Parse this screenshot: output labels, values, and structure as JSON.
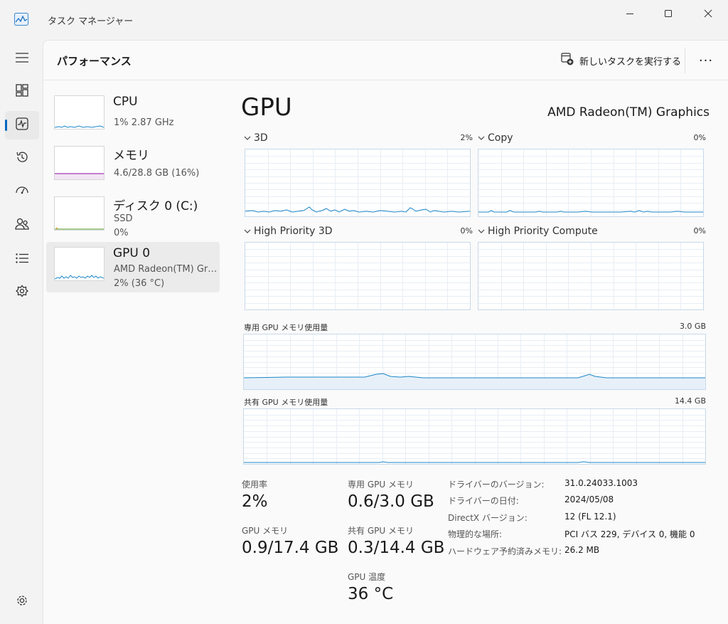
{
  "window": {
    "title": "タスク マネージャー",
    "icon": "task-manager-icon"
  },
  "header": {
    "page_title": "パフォーマンス",
    "run_task_label": "新しいタスクを実行する",
    "more_label": "···"
  },
  "nav": [
    {
      "icon": "hamburger-icon"
    },
    {
      "icon": "processes-icon"
    },
    {
      "icon": "performance-icon",
      "active": true
    },
    {
      "icon": "app-history-icon"
    },
    {
      "icon": "startup-apps-icon"
    },
    {
      "icon": "users-icon"
    },
    {
      "icon": "details-icon"
    },
    {
      "icon": "services-icon"
    },
    {
      "icon": "settings-icon"
    }
  ],
  "devices": [
    {
      "name": "CPU",
      "line1": "1%  2.87 GHz",
      "line2": "",
      "color": "#1a86c8"
    },
    {
      "name": "メモリ",
      "line1": "4.6/28.8 GB (16%)",
      "line2": "",
      "color": "#a23bb0"
    },
    {
      "name": "ディスク 0 (C:)",
      "line1": "SSD",
      "line2": "0%",
      "color": "#4c9a2a"
    },
    {
      "name": "GPU 0",
      "line1": "AMD Radeon(TM) Graphics",
      "line2": "2%  (36 °C)",
      "color": "#1a86c8",
      "selected": true
    }
  ],
  "detail": {
    "title": "GPU",
    "model": "AMD Radeon(TM) Graphics",
    "engines": [
      {
        "label": "3D",
        "pct": "2%"
      },
      {
        "label": "Copy",
        "pct": "0%"
      },
      {
        "label": "High Priority 3D",
        "pct": "0%"
      },
      {
        "label": "High Priority Compute",
        "pct": "0%"
      }
    ],
    "dedicated_mem": {
      "label": "専用 GPU メモリ使用量",
      "max": "3.0 GB"
    },
    "shared_mem": {
      "label": "共有 GPU メモリ使用量",
      "max": "14.4 GB"
    },
    "stats": {
      "usage_label": "使用率",
      "usage_value": "2%",
      "gpu_mem_label": "GPU メモリ",
      "gpu_mem_value": "0.9/17.4 GB",
      "ded_label": "専用 GPU メモリ",
      "ded_value": "0.6/3.0 GB",
      "shared_label": "共有 GPU メモリ",
      "shared_value": "0.3/14.4 GB",
      "temp_label": "GPU 温度",
      "temp_value": "36 °C"
    },
    "info": [
      {
        "key": "ドライバーのバージョン:",
        "value": "31.0.24033.1003"
      },
      {
        "key": "ドライバーの日付:",
        "value": "2024/05/08"
      },
      {
        "key": "DirectX バージョン:",
        "value": "12 (FL 12.1)"
      },
      {
        "key": "物理的な場所:",
        "value": "PCI バス 229, デバイス 0, 機能 0"
      },
      {
        "key": "ハードウェア予約済みメモリ:",
        "value": "26.2 MB"
      }
    ]
  },
  "colors": {
    "accent": "#0067c0",
    "graph_line": "#1a86c8",
    "graph_border": "#c7d9e9",
    "grid": "#e8eef4"
  }
}
